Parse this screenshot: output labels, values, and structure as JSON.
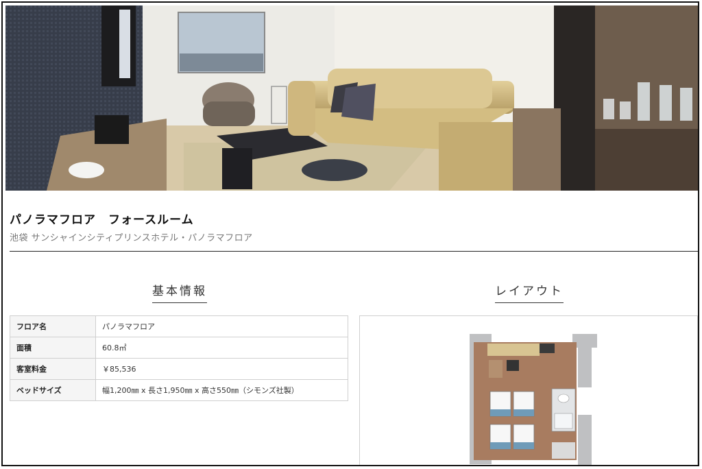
{
  "room": {
    "title": "パノラマフロア　フォースルーム",
    "hotel": "池袋 サンシャインシティプリンスホテル・パノラマフロア"
  },
  "sections": {
    "info_heading": "基本情報",
    "layout_heading": "レイアウト"
  },
  "info_rows": [
    {
      "label": "フロア名",
      "value": "パノラマフロア"
    },
    {
      "label": "面積",
      "value": "60.8㎡"
    },
    {
      "label": "客室料金",
      "value": "￥85,536"
    },
    {
      "label": "ベッドサイズ",
      "value": "幅1,200㎜ x 長さ1,950㎜ x 高さ550㎜（シモンズ社製）"
    }
  ],
  "images": {
    "hero": "hotel-room-photo",
    "floorplan": "room-floor-plan"
  }
}
